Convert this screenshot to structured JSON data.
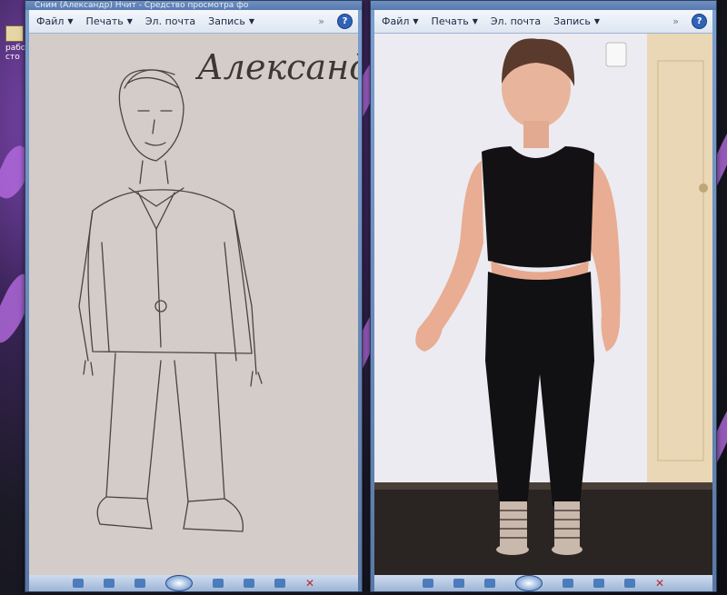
{
  "desktop": {
    "icon_label": "рабо сто"
  },
  "window_left": {
    "title": "Сним (Александр) Нчит - Средство просмотра фо",
    "menu": [
      {
        "label": "Файл"
      },
      {
        "label": "Печать"
      },
      {
        "label": "Эл. почта"
      },
      {
        "label": "Запись"
      }
    ],
    "drawing_signature": "Александ"
  },
  "window_right": {
    "menu": [
      {
        "label": "Файл"
      },
      {
        "label": "Печать"
      },
      {
        "label": "Эл. почта"
      },
      {
        "label": "Запись"
      }
    ]
  },
  "icons": {
    "more": "chevron-more-icon",
    "help": "help-icon",
    "close": "close-icon"
  },
  "colors": {
    "menubar": "#e7eef7",
    "window_frame": "#5a78a5",
    "desktop": "#3b2458"
  }
}
